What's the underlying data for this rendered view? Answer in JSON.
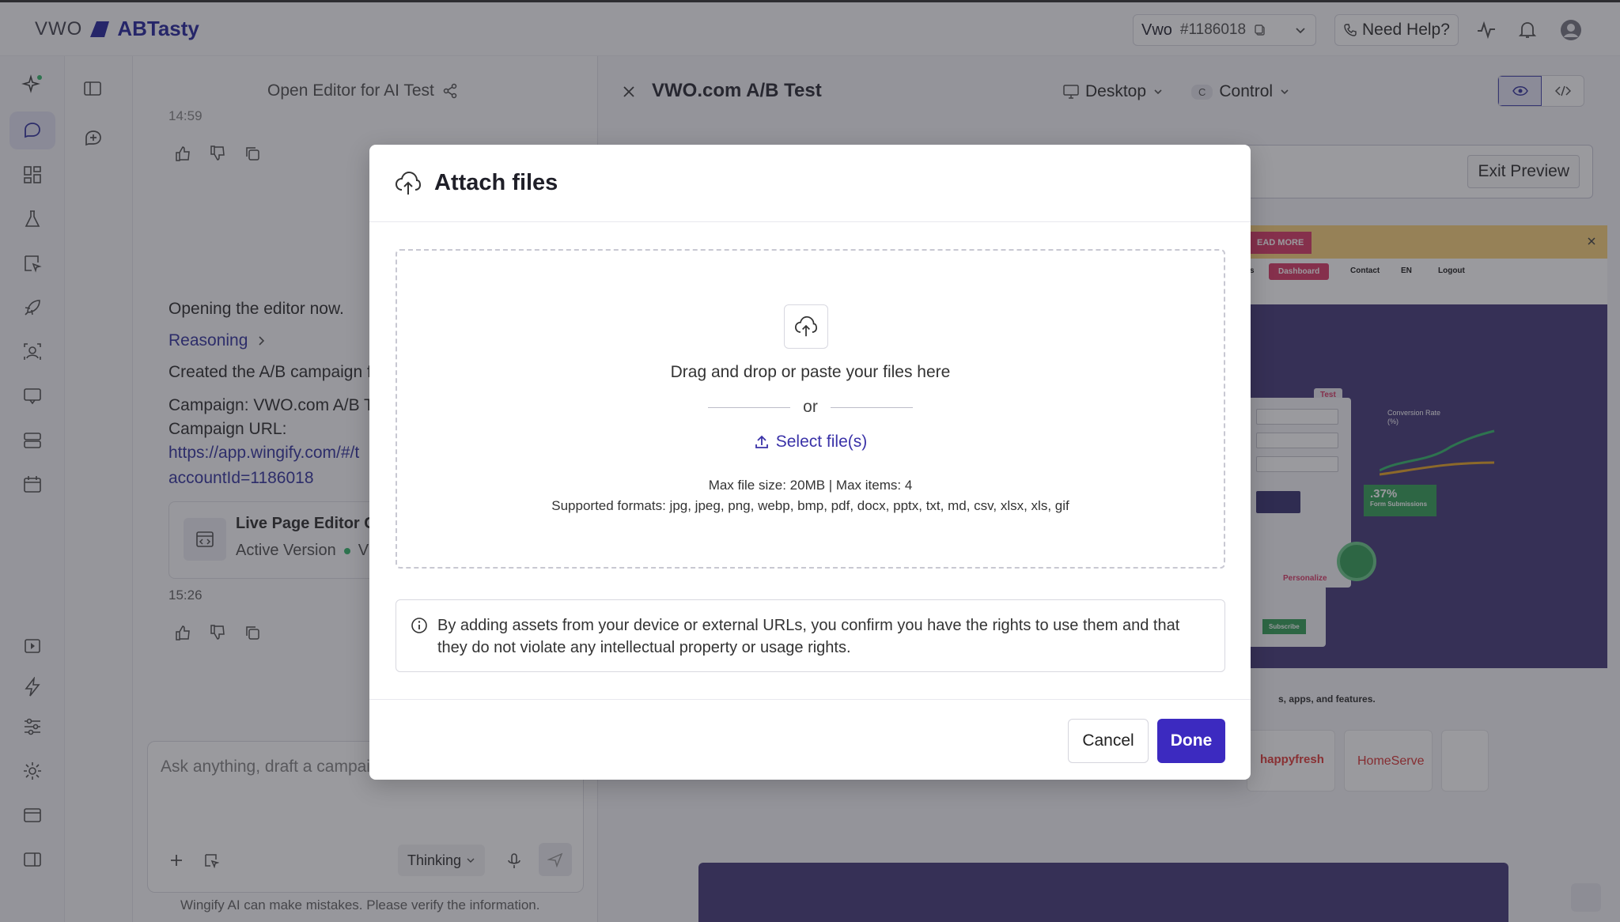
{
  "header": {
    "brand_vwo": "VWO",
    "brand_abtasty": "ABTasty",
    "workspace_name": "Vwo",
    "workspace_id": "#1186018",
    "help_label": "Need Help?"
  },
  "chat": {
    "title": "Open Editor for AI Test",
    "timestamp_top": "14:59",
    "msg_opening": "Opening the editor now.",
    "reasoning_label": "Reasoning",
    "msg_created": "Created the A/B campaign f",
    "campaign_line": "Campaign: VWO.com A/B T",
    "campaign_url_label": "Campaign URL:",
    "campaign_url_part1": "https://app.wingify.com/#/t",
    "campaign_url_part2": "accountId=1186018",
    "card_title": "Live Page Editor C",
    "card_status": "Active Version",
    "card_status_suffix": "V",
    "timestamp_bottom": "15:26",
    "input_placeholder": "Ask anything, draft a campai",
    "thinking_label": "Thinking",
    "disclaimer": "Wingify AI can make mistakes. Please verify the information."
  },
  "preview": {
    "title": "VWO.com A/B Test",
    "device_label": "Desktop",
    "variation_badge": "C",
    "variation_label": "Control",
    "exit_label": "Exit Preview",
    "banner_button": "EAD MORE",
    "nav_items": [
      "s",
      "Dashboard",
      "Contact",
      "EN",
      "Logout"
    ],
    "test_badge": "Test",
    "chart_label": "Conversion Rate (%)",
    "stat_value": ".37%",
    "stat_label": "Form Submissions",
    "personalize_badge": "Personalize",
    "subscribe_label": "Subscribe",
    "footer_text": "s, apps, and features.",
    "logo_1": "happyfresh",
    "logo_2": "HomeServe"
  },
  "modal": {
    "title": "Attach files",
    "drop_text": "Drag and drop or paste your files here",
    "or_text": "or",
    "select_label": "Select file(s)",
    "limits": "Max file size: 20MB | Max items: 4",
    "formats": "Supported formats: jpg, jpeg, png, webp, bmp, pdf, docx, pptx, txt, md, csv, xlsx, xls, gif",
    "notice": "By adding assets from your device or external URLs, you confirm you have the rights to use them and that they do not violate any intellectual property or usage rights.",
    "cancel_label": "Cancel",
    "done_label": "Done"
  },
  "colors": {
    "accent": "#3c2ac0",
    "link": "#3a32a8",
    "overlay": "rgba(30,30,40,0.45)"
  }
}
